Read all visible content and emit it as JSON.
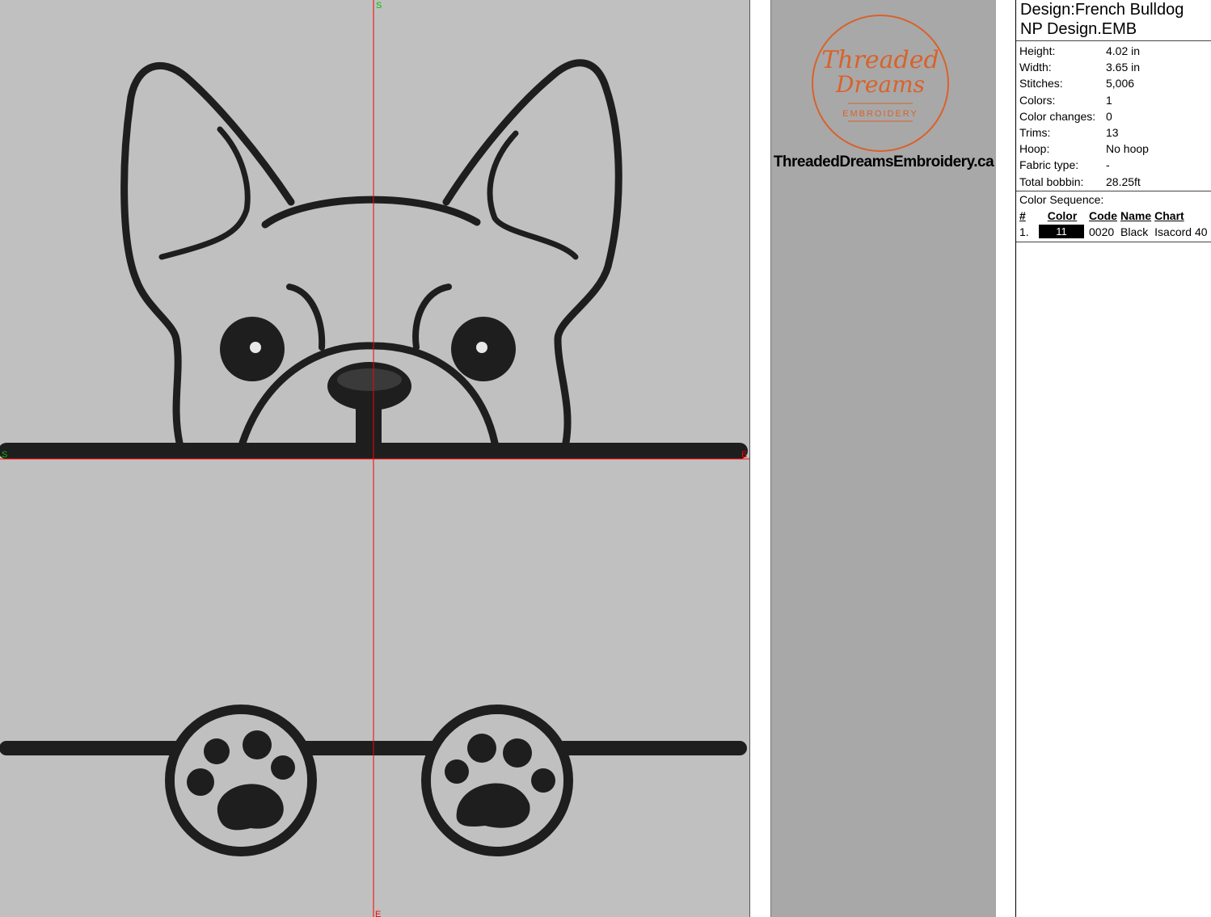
{
  "design": {
    "title_line1": "Design:French Bulldog",
    "title_line2": "NP Design.EMB"
  },
  "properties": [
    {
      "label": "Height:",
      "value": "4.02 in"
    },
    {
      "label": "Width:",
      "value": "3.65 in"
    },
    {
      "label": "Stitches:",
      "value": "5,006"
    },
    {
      "label": "Colors:",
      "value": "1"
    },
    {
      "label": "Color changes:",
      "value": "0"
    },
    {
      "label": "Trims:",
      "value": "13"
    },
    {
      "label": "Hoop:",
      "value": "No hoop"
    },
    {
      "label": "Fabric type:",
      "value": "-"
    },
    {
      "label": "Total bobbin:",
      "value": "28.25ft"
    }
  ],
  "color_sequence": {
    "label": "Color Sequence:",
    "headers": {
      "num": "#",
      "color": "Color",
      "code": "Code",
      "name": "Name",
      "chart": "Chart"
    },
    "rows": [
      {
        "num": "1.",
        "color_number": "11",
        "swatch": "#000000",
        "code": "0020",
        "name": "Black",
        "chart": "Isacord 40"
      }
    ]
  },
  "logo": {
    "line1": "Threaded",
    "line2": "Dreams",
    "line3": "EMBROIDERY",
    "accent": "#d9622b",
    "website": "ThreadedDreamsEmbroidery.ca"
  },
  "canvas": {
    "background": "#c0c0c0",
    "thread_color": "#1a1a1a",
    "axis_color": "#ff0000",
    "marker_s": "S",
    "marker_e": "E",
    "marker_s_color": "#00c000"
  }
}
